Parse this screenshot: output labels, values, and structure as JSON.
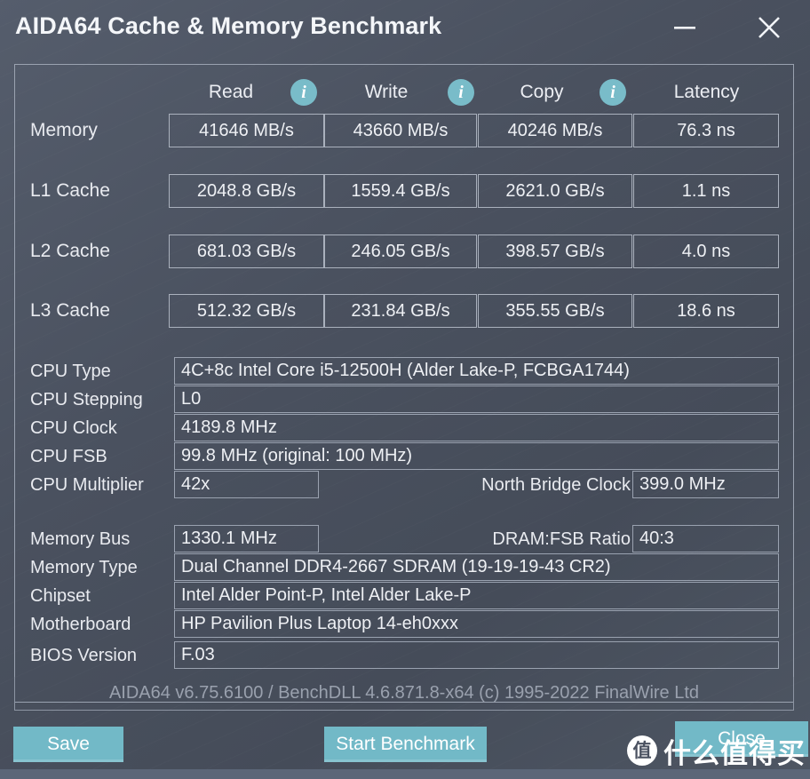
{
  "window": {
    "title": "AIDA64 Cache & Memory Benchmark",
    "minimize_label": "–",
    "close_label": "✕",
    "accent_color": "#72b9c7",
    "background_color": "#4a5160",
    "border_color": "#9aa2b0"
  },
  "benchmark": {
    "columns": [
      {
        "label": "Read",
        "icon": "info-icon",
        "has_info": true
      },
      {
        "label": "Write",
        "icon": "info-icon",
        "has_info": true
      },
      {
        "label": "Copy",
        "icon": "info-icon",
        "has_info": true
      },
      {
        "label": "Latency",
        "icon": "",
        "has_info": false
      }
    ],
    "rows": [
      {
        "label": "Memory",
        "read": "41646 MB/s",
        "write": "43660 MB/s",
        "copy": "40246 MB/s",
        "latency": "76.3 ns"
      },
      {
        "label": "L1 Cache",
        "read": "2048.8 GB/s",
        "write": "1559.4 GB/s",
        "copy": "2621.0 GB/s",
        "latency": "1.1 ns"
      },
      {
        "label": "L2 Cache",
        "read": "681.03 GB/s",
        "write": "246.05 GB/s",
        "copy": "398.57 GB/s",
        "latency": "4.0 ns"
      },
      {
        "label": "L3 Cache",
        "read": "512.32 GB/s",
        "write": "231.84 GB/s",
        "copy": "355.55 GB/s",
        "latency": "18.6 ns"
      }
    ]
  },
  "cpu_info": {
    "cpu_type_label": "CPU Type",
    "cpu_type_value": "4C+8c Intel Core i5-12500H  (Alder Lake-P, FCBGA1744)",
    "cpu_stepping_label": "CPU Stepping",
    "cpu_stepping_value": "L0",
    "cpu_clock_label": "CPU Clock",
    "cpu_clock_value": "4189.8 MHz",
    "cpu_fsb_label": "CPU FSB",
    "cpu_fsb_value": "99.8 MHz  (original: 100 MHz)",
    "cpu_multiplier_label": "CPU Multiplier",
    "cpu_multiplier_value": "42x",
    "north_bridge_clock_label": "North Bridge Clock",
    "north_bridge_clock_value": "399.0 MHz"
  },
  "memory_info": {
    "memory_bus_label": "Memory Bus",
    "memory_bus_value": "1330.1 MHz",
    "dram_fsb_ratio_label": "DRAM:FSB Ratio",
    "dram_fsb_ratio_value": "40:3",
    "memory_type_label": "Memory Type",
    "memory_type_value": "Dual Channel DDR4-2667 SDRAM  (19-19-19-43 CR2)",
    "chipset_label": "Chipset",
    "chipset_value": "Intel Alder Point-P, Intel Alder Lake-P",
    "motherboard_label": "Motherboard",
    "motherboard_value": "HP Pavilion Plus Laptop 14-eh0xxx",
    "bios_version_label": "BIOS Version",
    "bios_version_value": "F.03"
  },
  "footer": {
    "version_text": "AIDA64 v6.75.6100 / BenchDLL 4.6.871.8-x64  (c) 1995-2022 FinalWire Ltd",
    "save_label": "Save",
    "start_benchmark_label": "Start Benchmark",
    "close_label": "Close"
  },
  "watermark": {
    "badge": "值",
    "text": "什么值得买"
  }
}
